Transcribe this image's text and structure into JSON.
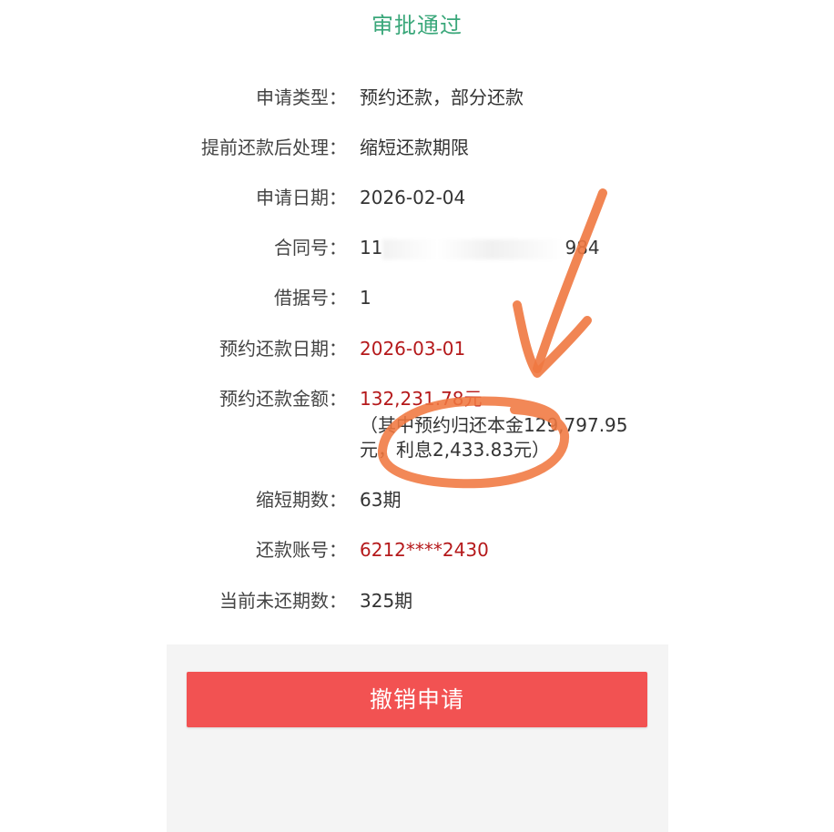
{
  "header": {
    "status": "审批通过"
  },
  "details": [
    {
      "label": "申请类型：",
      "value": "预约还款，部分还款"
    },
    {
      "label": "提前还款后处理：",
      "value": "缩短还款期限"
    },
    {
      "label": "申请日期：",
      "value": "2026-02-04"
    },
    {
      "label": "合同号：",
      "value_prefix": "11",
      "value_suffix": "984"
    },
    {
      "label": "借据号：",
      "value": "1"
    },
    {
      "label": "预约还款日期：",
      "value": "2026-03-01"
    },
    {
      "label": "预约还款金额：",
      "value": "132,231.78元",
      "note_line1": "（其中预约归还本金129,797.95",
      "note_line2": "元，利息2,433.83元）"
    },
    {
      "label": "缩短期数：",
      "value": "63期"
    },
    {
      "label": "还款账号：",
      "value": "6212****2430"
    },
    {
      "label": "当前未还期数：",
      "value": "325期"
    }
  ],
  "actions": {
    "cancel_label": "撤销申请"
  },
  "colors": {
    "status_green": "#3aa77a",
    "highlight_red": "#b5191b",
    "button_red": "#f25252",
    "annotation_orange": "#f07840"
  }
}
